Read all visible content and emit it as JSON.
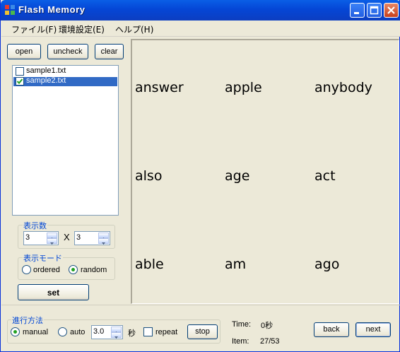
{
  "window": {
    "title": "Flash Memory",
    "controls": {
      "minimize": "minimize",
      "maximize": "maximize",
      "close": "close"
    }
  },
  "menu": {
    "items": [
      "ファイル(F)",
      "環境設定(E)",
      "ヘルプ(H)"
    ]
  },
  "toolbar": {
    "open_label": "open",
    "uncheck_label": "uncheck",
    "clear_label": "clear"
  },
  "file_list": {
    "items": [
      {
        "name": "sample1.txt",
        "checked": false,
        "selected": false
      },
      {
        "name": "sample2.txt",
        "checked": true,
        "selected": true
      }
    ]
  },
  "display_count": {
    "title": "表示数",
    "rows": "3",
    "separator": "X",
    "cols": "3"
  },
  "display_mode": {
    "title": "表示モード",
    "ordered_label": "ordered",
    "random_label": "random",
    "selected": "random"
  },
  "set_label": "set",
  "words": [
    "answer",
    "apple",
    "anybody",
    "also",
    "age",
    "act",
    "able",
    "am",
    "ago"
  ],
  "progress": {
    "title": "進行方法",
    "manual_label": "manual",
    "auto_label": "auto",
    "selected": "manual",
    "interval": "3.0",
    "unit": "秒",
    "repeat_label": "repeat",
    "repeat_checked": false,
    "stop_label": "stop"
  },
  "status": {
    "time_label": "Time:",
    "time_value": "0秒",
    "item_label": "Item:",
    "item_value": "27/53"
  },
  "nav": {
    "back_label": "back",
    "next_label": "next"
  },
  "colors": {
    "titlebar": "#0a5fe6",
    "selection": "#316ac5",
    "group_title": "#0046d5",
    "radio_dot": "#21a121",
    "window_bg": "#ece9d8"
  }
}
